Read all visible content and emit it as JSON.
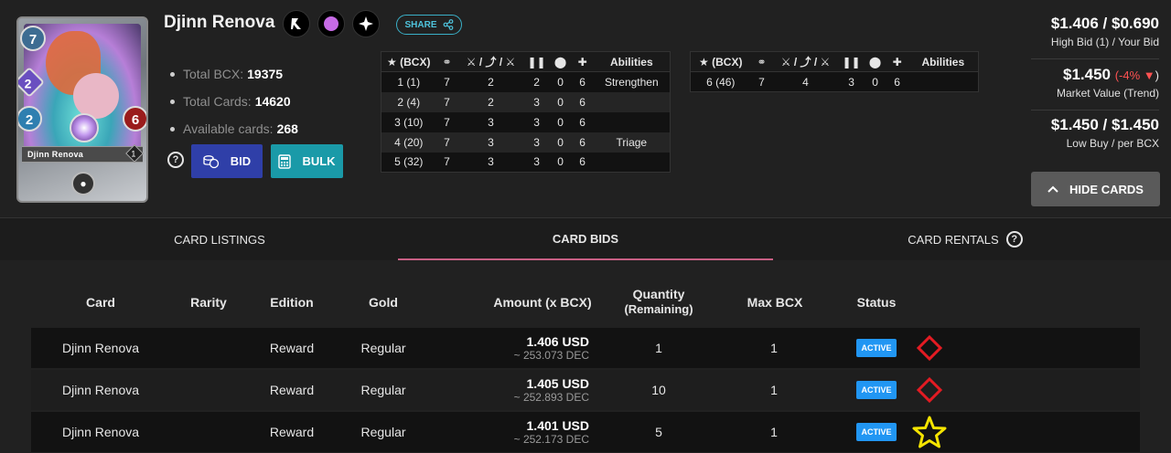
{
  "card": {
    "name": "Djinn Renova",
    "mana": "7",
    "speed": "2",
    "armor": "2",
    "health": "6",
    "level": "1",
    "stats": [
      {
        "label": "Total BCX:",
        "value": "19375"
      },
      {
        "label": "Total Cards:",
        "value": "14620"
      },
      {
        "label": "Available cards:",
        "value": "268"
      }
    ]
  },
  "header": {
    "share_label": "SHARE",
    "bid_label": "BID",
    "bulk_label": "BULK",
    "help_icon": "?"
  },
  "level_table_1": {
    "headers": [
      "(BCX)",
      "",
      "/ /",
      "",
      "",
      "",
      "Abilities"
    ],
    "rows": [
      [
        "1 (1)",
        "7",
        "2",
        "2",
        "0",
        "6",
        "Strengthen"
      ],
      [
        "2 (4)",
        "7",
        "2",
        "3",
        "0",
        "6",
        ""
      ],
      [
        "3 (10)",
        "7",
        "3",
        "3",
        "0",
        "6",
        ""
      ],
      [
        "4 (20)",
        "7",
        "3",
        "3",
        "0",
        "6",
        "Triage"
      ],
      [
        "5 (32)",
        "7",
        "3",
        "3",
        "0",
        "6",
        ""
      ]
    ]
  },
  "level_table_2": {
    "headers": [
      "(BCX)",
      "",
      "/ /",
      "",
      "",
      "",
      "Abilities"
    ],
    "rows": [
      [
        "6 (46)",
        "7",
        "4",
        "3",
        "0",
        "6",
        ""
      ]
    ]
  },
  "prices": {
    "high_bid": "$1.406 / $0.690",
    "high_bid_label": "High Bid (1) / Your Bid",
    "market_value": "$1.450",
    "trend": "(-4%",
    "trend_close": ")",
    "market_label": "Market Value (Trend)",
    "low_buy": "$1.450 / $1.450",
    "low_buy_label": "Low Buy / per BCX",
    "hide_label": "HIDE CARDS"
  },
  "tabs": [
    {
      "label": "CARD LISTINGS"
    },
    {
      "label": "CARD BIDS"
    },
    {
      "label": "CARD RENTALS"
    }
  ],
  "bids_table": {
    "headers": [
      "Card",
      "Rarity",
      "Edition",
      "Gold",
      "Amount (x BCX)",
      "Quantity",
      "(Remaining)",
      "Max BCX",
      "Status"
    ],
    "rows": [
      {
        "card": "Djinn Renova",
        "edition": "Reward",
        "gold": "Regular",
        "usd": "1.406 USD",
        "dec": "~ 253.073 DEC",
        "qty": "1",
        "max": "1",
        "status": "ACTIVE",
        "marker": "red-diamond"
      },
      {
        "card": "Djinn Renova",
        "edition": "Reward",
        "gold": "Regular",
        "usd": "1.405 USD",
        "dec": "~ 252.893 DEC",
        "qty": "10",
        "max": "1",
        "status": "ACTIVE",
        "marker": "red-diamond"
      },
      {
        "card": "Djinn Renova",
        "edition": "Reward",
        "gold": "Regular",
        "usd": "1.401 USD",
        "dec": "~ 252.173 DEC",
        "qty": "5",
        "max": "1",
        "status": "ACTIVE",
        "marker": "yellow-star"
      }
    ]
  },
  "colors": {
    "accent_tab": "#c75f84",
    "bid_button": "#2f3fa8",
    "bulk_button": "#1a9aa8",
    "active_badge": "#2196f3",
    "trend_down": "#ff5252",
    "marker_diamond": "#e31b23",
    "marker_star": "#f5e400"
  }
}
